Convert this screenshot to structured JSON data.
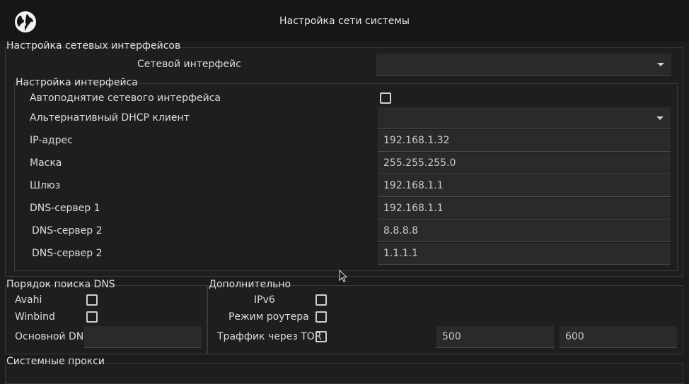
{
  "window": {
    "title": "Настройка сети системы",
    "icon": "globe-icon"
  },
  "network_interfaces": {
    "title": "Настройка сетевых интерфейсов",
    "interface_label": "Сетевой интерфейс",
    "interface_value": ""
  },
  "interface_settings": {
    "title": "Настройка интерфейса",
    "autostart_label": "Автоподнятие сетевого интерфейса",
    "autostart_checked": false,
    "dhcp_label": "Альтернативный DHCP клиент",
    "dhcp_value": "",
    "ip_label": "IP-адрес",
    "ip_value": "192.168.1.32",
    "mask_label": "Маска",
    "mask_value": "255.255.255.0",
    "gateway_label": "Шлюз",
    "gateway_value": "192.168.1.1",
    "dns1_label": "DNS-сервер 1",
    "dns1_value": "192.168.1.1",
    "dns2_label": "DNS-сервер 2",
    "dns2_value": "8.8.8.8",
    "dns3_label": "DNS-сервер 2",
    "dns3_value": "1.1.1.1"
  },
  "dns_search": {
    "title": "Порядок поиска DNS",
    "avahi_label": "Avahi",
    "avahi_checked": false,
    "winbind_label": "Winbind",
    "winbind_checked": false,
    "primary_dns_label": "Основной DNS",
    "primary_dns_value": ""
  },
  "additional": {
    "title": "Дополнительно",
    "ipv6_label": "IPv6",
    "ipv6_checked": false,
    "router_label": "Режим роутера",
    "router_checked": false,
    "tor_label": "Траффик через TOR",
    "tor_checked": false,
    "field1_value": "500",
    "field2_value": "600"
  },
  "system_proxy": {
    "title": "Системные прокси"
  },
  "colors": {
    "background": "#1c1c1c",
    "field": "#2a2a2a",
    "text": "#dedede"
  }
}
